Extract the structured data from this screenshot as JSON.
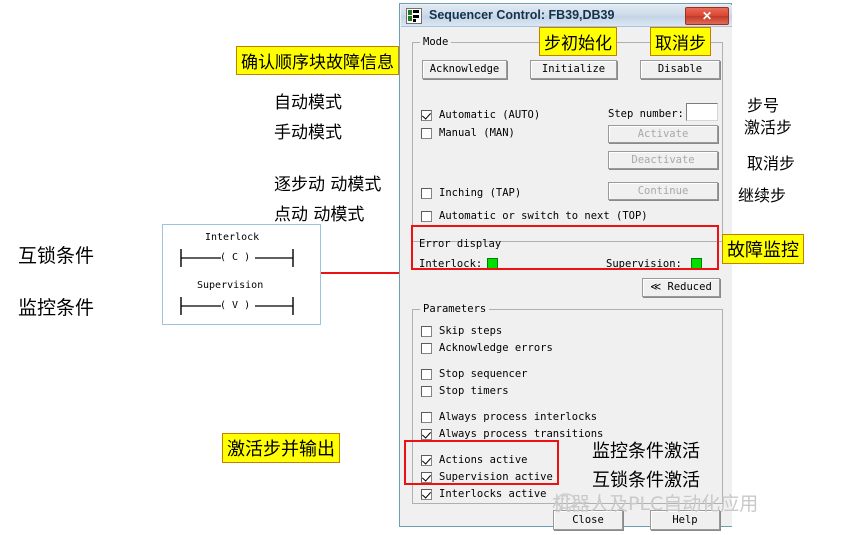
{
  "dialog": {
    "title": "Sequencer Control: FB39,DB39",
    "icon": "sequencer-icon",
    "close_label": "✕",
    "mode_group": {
      "legend": "Mode",
      "buttons": [
        {
          "label": "Acknowledge",
          "enabled": true
        },
        {
          "label": "Initialize",
          "enabled": true
        },
        {
          "label": "Disable",
          "enabled": true
        }
      ],
      "checkboxes": [
        {
          "label": "Automatic (AUTO)",
          "checked": true
        },
        {
          "label": "Manual (MAN)",
          "checked": false
        },
        {
          "label": "Inching (TAP)",
          "checked": false
        },
        {
          "label": "Automatic or switch to next (TOP)",
          "checked": false
        }
      ],
      "step_number_label": "Step number:",
      "step_number_value": "",
      "step_buttons": [
        {
          "label": "Activate",
          "enabled": false
        },
        {
          "label": "Deactivate",
          "enabled": false
        },
        {
          "label": "Continue",
          "enabled": false
        }
      ]
    },
    "error_display": {
      "title": "Error display",
      "interlock_label": "Interlock:",
      "interlock_state": "ok",
      "supervision_label": "Supervision:",
      "supervision_state": "ok",
      "led_color": "#00e000"
    },
    "reduced_button": "≪ Reduced",
    "parameters_group": {
      "legend": "Parameters",
      "checkboxes": [
        {
          "label": "Skip steps",
          "checked": false
        },
        {
          "label": "Acknowledge errors",
          "checked": false
        },
        {
          "label": "Stop sequencer",
          "checked": false
        },
        {
          "label": "Stop timers",
          "checked": false
        },
        {
          "label": "Always process interlocks",
          "checked": false
        },
        {
          "label": "Always process transitions",
          "checked": true
        },
        {
          "label": "Actions active",
          "checked": true
        },
        {
          "label": "Supervision active",
          "checked": true
        },
        {
          "label": "Interlocks active",
          "checked": true
        }
      ]
    },
    "footer_buttons": [
      {
        "label": "Close"
      },
      {
        "label": "Help"
      }
    ]
  },
  "ladder": {
    "rung1_label": "Interlock",
    "rung1_coil": "( C )",
    "rung2_label": "Supervision",
    "rung2_coil": "( V )"
  },
  "annotations": {
    "ack_fault_info": "确认顺序块故障信息",
    "step_init": "步初始化",
    "cancel_step": "取消步",
    "auto_mode": "自动模式",
    "manual_mode": "手动模式",
    "step_by_step_mode": "逐步动 动模式",
    "jog_mode": "点动 动模式",
    "interlock_condition": "互锁条件",
    "supervision_condition": "监控条件",
    "step_number": "步号",
    "activate_step": "激活步",
    "deactivate_step": "取消步",
    "continue_step": "继续步",
    "fault_monitor": "故障监控",
    "activate_step_output": "激活步并输出",
    "supervision_active": "监控条件激活",
    "interlocks_active": "互锁条件激活"
  },
  "watermark": {
    "text": "机器人及PLC自动化应用",
    "icon": "wechat-icon"
  },
  "colors": {
    "highlight": "#ffff00",
    "annotation_red": "#ee1111",
    "led_green": "#00e000",
    "title_blue": "#15314b"
  }
}
